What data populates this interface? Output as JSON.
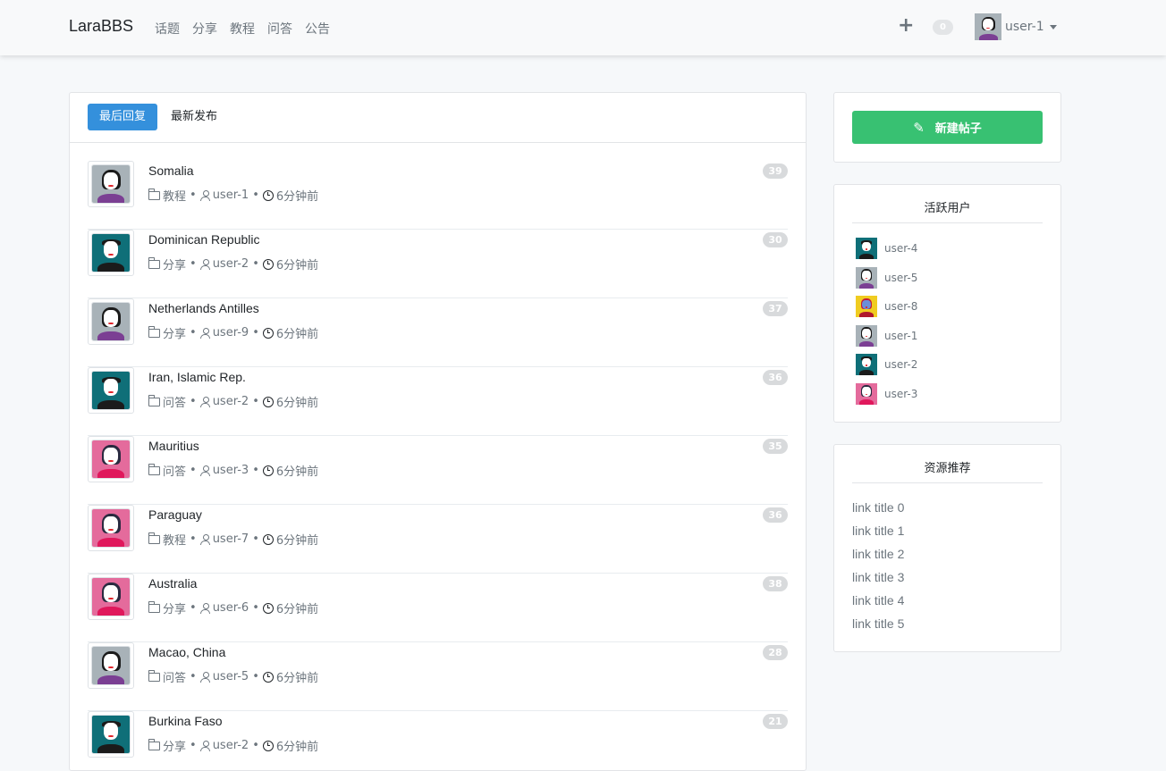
{
  "navbar": {
    "brand": "LaraBBS",
    "links": [
      "话题",
      "分享",
      "教程",
      "问答",
      "公告"
    ],
    "notification_count": "0",
    "user_name": "user-1"
  },
  "tabs": {
    "active": "最后回复",
    "inactive": "最新发布"
  },
  "topics": [
    {
      "title": "Somalia",
      "category": "教程",
      "author": "user-1",
      "time": "6分钟前",
      "replies": "39",
      "avatar": "gray"
    },
    {
      "title": "Dominican Republic",
      "category": "分享",
      "author": "user-2",
      "time": "6分钟前",
      "replies": "30",
      "avatar": "teal"
    },
    {
      "title": "Netherlands Antilles",
      "category": "分享",
      "author": "user-9",
      "time": "6分钟前",
      "replies": "37",
      "avatar": "gray"
    },
    {
      "title": "Iran, Islamic Rep.",
      "category": "问答",
      "author": "user-2",
      "time": "6分钟前",
      "replies": "36",
      "avatar": "teal"
    },
    {
      "title": "Mauritius",
      "category": "问答",
      "author": "user-3",
      "time": "6分钟前",
      "replies": "35",
      "avatar": "pink"
    },
    {
      "title": "Paraguay",
      "category": "教程",
      "author": "user-7",
      "time": "6分钟前",
      "replies": "36",
      "avatar": "pink"
    },
    {
      "title": "Australia",
      "category": "分享",
      "author": "user-6",
      "time": "6分钟前",
      "replies": "38",
      "avatar": "pink"
    },
    {
      "title": "Macao, China",
      "category": "问答",
      "author": "user-5",
      "time": "6分钟前",
      "replies": "28",
      "avatar": "gray"
    },
    {
      "title": "Burkina Faso",
      "category": "分享",
      "author": "user-2",
      "time": "6分钟前",
      "replies": "21",
      "avatar": "teal"
    }
  ],
  "sidebar": {
    "new_post_label": "新建帖子",
    "active_users_title": "活跃用户",
    "active_users": [
      {
        "name": "user-4",
        "avatar": "teal"
      },
      {
        "name": "user-5",
        "avatar": "gray"
      },
      {
        "name": "user-8",
        "avatar": "yellow"
      },
      {
        "name": "user-1",
        "avatar": "gray"
      },
      {
        "name": "user-2",
        "avatar": "teal"
      },
      {
        "name": "user-3",
        "avatar": "pink"
      }
    ],
    "resources_title": "资源推荐",
    "links": [
      "link title 0",
      "link title 1",
      "link title 2",
      "link title 3",
      "link title 4",
      "link title 5"
    ]
  },
  "colors": {
    "primary": "#3490dc",
    "success": "#38c172",
    "muted": "#6c757d",
    "badge": "#d8dadc"
  }
}
